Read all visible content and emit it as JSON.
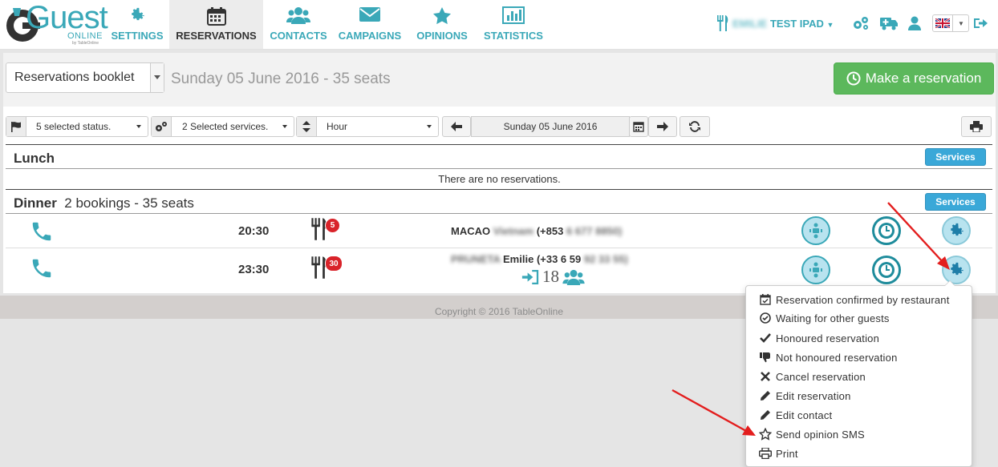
{
  "app": {
    "logo_text": "Guest",
    "logo_sub": "ONLINE",
    "logo_by": "by TableOnline"
  },
  "nav": {
    "items": [
      {
        "label": "SETTINGS",
        "icon": "gear-icon"
      },
      {
        "label": "RESERVATIONS",
        "icon": "calendar-icon"
      },
      {
        "label": "CONTACTS",
        "icon": "users-icon"
      },
      {
        "label": "CAMPAIGNS",
        "icon": "envelope-icon"
      },
      {
        "label": "OPINIONS",
        "icon": "star-icon"
      },
      {
        "label": "STATISTICS",
        "icon": "bar-chart-icon"
      }
    ],
    "active": "RESERVATIONS"
  },
  "user": {
    "restaurant_blurred": "EMILIE",
    "name": "TEST IPAD"
  },
  "booklet": {
    "select_value": "Reservations booklet",
    "title": "Sunday 05 June 2016 - 35 seats",
    "make_reservation_label": "Make a reservation"
  },
  "filters": {
    "status": "5 selected status.",
    "services": "2 Selected services.",
    "sort": "Hour",
    "date": "Sunday 05 June 2016"
  },
  "sections": {
    "lunch": {
      "title": "Lunch",
      "services_label": "Services",
      "empty_text": "There are no reservations."
    },
    "dinner": {
      "title": "Dinner",
      "summary": "2 bookings - 35 seats",
      "services_label": "Services"
    }
  },
  "reservations": [
    {
      "time": "20:30",
      "badge": "5",
      "guest_prefix": "MACAO",
      "guest_blurred": "Vietnam",
      "phone_prefix": "(+853",
      "phone_blurred": "6 677 8850)"
    },
    {
      "time": "23:30",
      "badge": "30",
      "guest_blurred_name": "PRUNETA",
      "guest_name": "Emilie",
      "phone_prefix": "(+33 6 59",
      "phone_blurred": "92 33 55)",
      "arrived_count": "18"
    }
  ],
  "footer": {
    "copyright": "Copyright © 2016 TableOnline"
  },
  "menu": {
    "items": [
      {
        "label": "Reservation confirmed by restaurant",
        "icon": "calendar-check-icon"
      },
      {
        "label": "Waiting for other guests",
        "icon": "check-circle-icon"
      },
      {
        "label": "Honoured reservation",
        "icon": "check-icon"
      },
      {
        "label": "Not honoured reservation",
        "icon": "thumbs-down-icon"
      },
      {
        "label": "Cancel reservation",
        "icon": "times-icon"
      },
      {
        "label": "Edit reservation",
        "icon": "pencil-icon"
      },
      {
        "label": "Edit contact",
        "icon": "pencil-icon"
      },
      {
        "label": "Send opinion SMS",
        "icon": "star-outline-icon"
      },
      {
        "label": "Print",
        "icon": "print-icon"
      }
    ]
  },
  "colors": {
    "brand": "#3aa8b8",
    "success": "#5cb85c",
    "services": "#3aa8d8",
    "annotation_arrow": "#e31e1e"
  }
}
